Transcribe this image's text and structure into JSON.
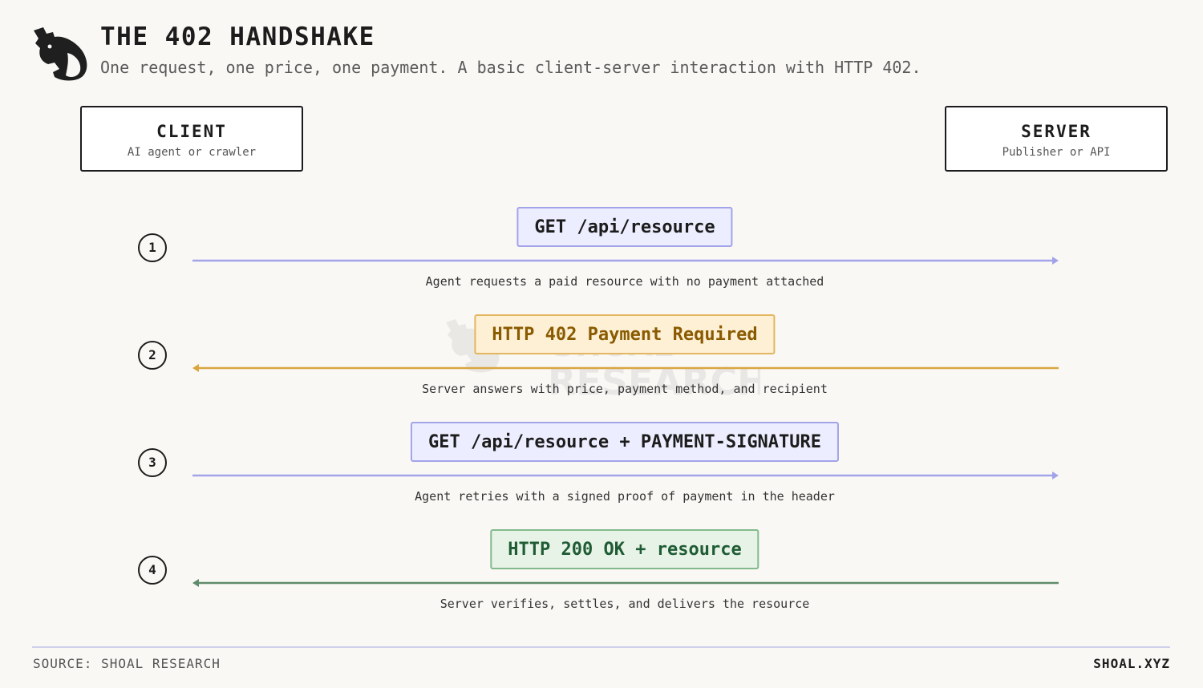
{
  "header": {
    "title": "THE 402 HANDSHAKE",
    "subtitle": "One request, one price, one payment. A basic client-server interaction with HTTP 402."
  },
  "actors": {
    "client": {
      "name": "CLIENT",
      "desc": "AI agent or crawler"
    },
    "server": {
      "name": "SERVER",
      "desc": "Publisher or API"
    }
  },
  "steps": [
    {
      "num": "1",
      "message": "GET /api/resource",
      "caption": "Agent requests a paid resource with no payment attached",
      "direction": "client-to-server",
      "color": "#a3a3ea"
    },
    {
      "num": "2",
      "message": "HTTP 402 Payment Required",
      "caption": "Server answers with price, payment method, and recipient",
      "direction": "server-to-client",
      "color": "#d9a640"
    },
    {
      "num": "3",
      "message": "GET /api/resource + PAYMENT-SIGNATURE",
      "caption": "Agent retries with a signed proof of payment in the header",
      "direction": "client-to-server",
      "color": "#a3a3ea"
    },
    {
      "num": "4",
      "message": "HTTP 200 OK + resource",
      "caption": "Server verifies, settles, and delivers the resource",
      "direction": "server-to-client",
      "color": "#5f8c6a"
    }
  ],
  "watermark": {
    "line1": "SHOAL",
    "line2": "RESEARCH"
  },
  "footer": {
    "source": "SOURCE: SHOAL RESEARCH",
    "brand": "SHOAL.XYZ"
  }
}
